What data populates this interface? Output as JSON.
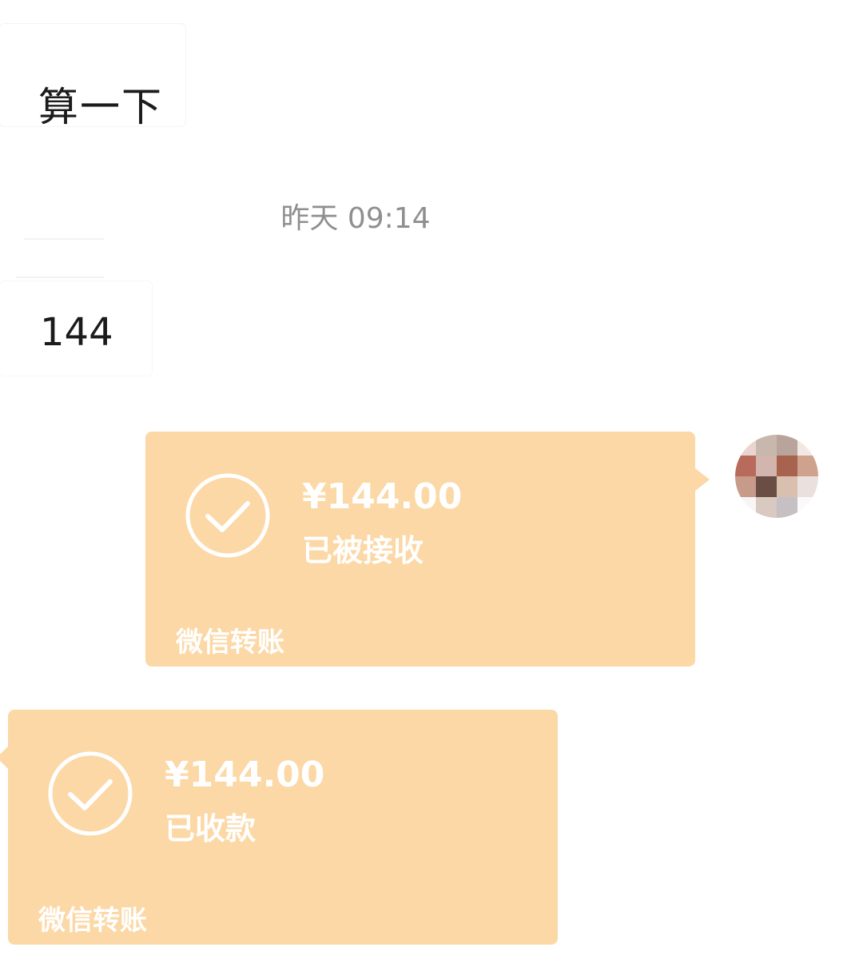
{
  "messages": {
    "incoming_1": "算一下",
    "timestamp": "昨天 09:14",
    "incoming_2": "144"
  },
  "transfers": {
    "sent": {
      "amount": "¥144.00",
      "status": "已被接收",
      "label": "微信转账",
      "icon": "check-circle-icon"
    },
    "received": {
      "amount": "¥144.00",
      "status": "已收款",
      "label": "微信转账",
      "icon": "check-circle-icon"
    }
  },
  "colors": {
    "transfer_card_bg": "#fbd8a6",
    "transfer_text": "#ffffff",
    "timestamp_text": "#8f8f8f",
    "page_bg": "#ffffff"
  },
  "avatar": {
    "pixel_colors": [
      "#e9d5cf",
      "#c7b7ad",
      "#b8a49a",
      "#f1e7e3",
      "#b86a5b",
      "#d2b6ad",
      "#a7634d",
      "#cfa28d",
      "#c79a8a",
      "#6a4d45",
      "#d8bfae",
      "#eae1de",
      "#f7f5f6",
      "#d9c9c0",
      "#c6c0c4",
      "#fbf9fa"
    ]
  }
}
